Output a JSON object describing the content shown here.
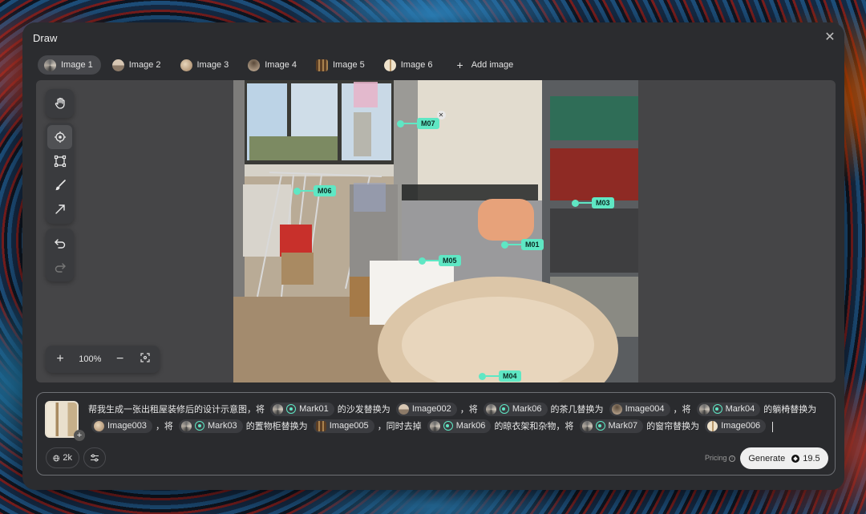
{
  "window": {
    "title": "Draw",
    "close_icon": "close-icon"
  },
  "tabs": [
    {
      "label": "Image 1",
      "active": true
    },
    {
      "label": "Image 2"
    },
    {
      "label": "Image 3"
    },
    {
      "label": "Image 4"
    },
    {
      "label": "Image 5"
    },
    {
      "label": "Image 6"
    }
  ],
  "add_image_label": "Add image",
  "toolbar": {
    "tools": [
      "hand-icon",
      "target-icon",
      "crop-frame-icon",
      "brush-icon",
      "arrow-icon",
      "undo-icon",
      "redo-icon"
    ],
    "selected": "target-icon"
  },
  "zoom": {
    "level": "100%"
  },
  "markers": [
    {
      "label": "M07",
      "removable": true
    },
    {
      "label": "M06"
    },
    {
      "label": "M03"
    },
    {
      "label": "M01"
    },
    {
      "label": "M05"
    },
    {
      "label": "M04"
    }
  ],
  "prompt": {
    "seg1": "帮我生成一张出租屋装修后的设计示意图，将",
    "chip1": "Mark01",
    "seg2": "的沙发替换为",
    "chip2": "Image002",
    "seg3": "，将",
    "chip3": "Mark06",
    "seg4": "的茶几替换为",
    "chip4": "Image004",
    "seg5": "，将",
    "chip5": "Mark04",
    "seg6": "的躺椅替换为",
    "chip6": "Image003",
    "seg7": "，将",
    "chip7": "Mark03",
    "seg8": "的置物柜替换为",
    "chip8": "Image005",
    "seg9": "，同时去掉",
    "chip9": "Mark06",
    "seg10": "的晾衣架和杂物，将",
    "chip10": "Mark07",
    "seg11": "的窗帘替换为",
    "chip11": "Image006"
  },
  "options": {
    "resolution": "2k"
  },
  "pricing_label": "Pricing",
  "generate": {
    "label": "Generate",
    "cost": "19.5"
  },
  "colors": {
    "accent": "#5fe7c4",
    "window_bg": "#2b2c2f",
    "canvas_bg": "#454547"
  }
}
